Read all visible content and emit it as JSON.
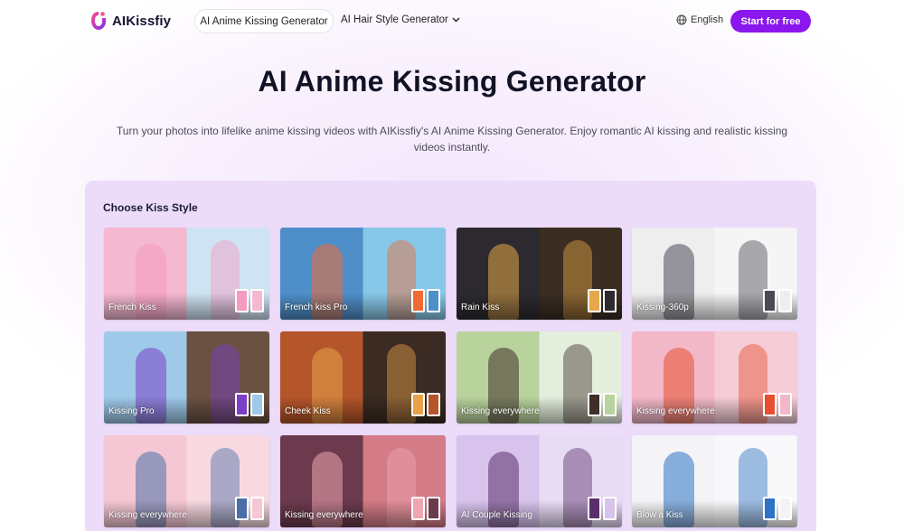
{
  "header": {
    "logo_text": "AIKissfiy",
    "nav_active": "AI Anime Kissing Generator",
    "nav_dropdown": "AI Hair Style Generator",
    "language": "English",
    "cta": "Start for free"
  },
  "hero": {
    "title": "AI Anime Kissing Generator",
    "subtitle": "Turn your photos into lifelike anime kissing videos with AIKissfiy's AI Anime Kissing Generator. Enjoy romantic AI kissing and realistic kissing videos instantly."
  },
  "styles": {
    "heading": "Choose Kiss Style",
    "cards": [
      {
        "label": "French Kiss",
        "bg_left": "#f4b8cf",
        "bg_right": "#cfe4f3",
        "accent": "#f59ac0"
      },
      {
        "label": "French kiss Pro",
        "bg_left": "#4f8fc9",
        "bg_right": "#87c7e8",
        "accent": "#f06b33"
      },
      {
        "label": "Rain Kiss",
        "bg_left": "#2c2a2e",
        "bg_right": "#3b2d22",
        "accent": "#e6a84a"
      },
      {
        "label": "Kissing-360p",
        "bg_left": "#eeeeee",
        "bg_right": "#f5f5f5",
        "accent": "#4a4a55"
      },
      {
        "label": "Kissing Pro",
        "bg_left": "#9ec9e9",
        "bg_right": "#6b5142",
        "accent": "#7b3fc9"
      },
      {
        "label": "Cheek Kiss",
        "bg_left": "#b4552a",
        "bg_right": "#3b2b22",
        "accent": "#e9a24b"
      },
      {
        "label": "Kissing everywhere",
        "bg_left": "#b9d39c",
        "bg_right": "#e4eedd",
        "accent": "#3f2e2a"
      },
      {
        "label": "Kissing everywhere",
        "bg_left": "#f3b8c8",
        "bg_right": "#f6cdd6",
        "accent": "#e6502f"
      },
      {
        "label": "Kissing everywhere",
        "bg_left": "#f5c7d4",
        "bg_right": "#f8d9e1",
        "accent": "#4a6fa8"
      },
      {
        "label": "Kissing everywhere",
        "bg_left": "#6b3a4d",
        "bg_right": "#d37b86",
        "accent": "#f0a6b2"
      },
      {
        "label": "AI Couple Kissing",
        "bg_left": "#d8c3ec",
        "bg_right": "#e8dcf5",
        "accent": "#5a2f6b"
      },
      {
        "label": "Blow a Kiss",
        "bg_left": "#f4f4f6",
        "bg_right": "#f8f8fa",
        "accent": "#2d72c4"
      }
    ]
  },
  "colors": {
    "brand": "#8a17ee",
    "panel": "#ecdcfa"
  },
  "icons": [
    "logo-icon",
    "chevron-down-icon",
    "globe-icon"
  ]
}
